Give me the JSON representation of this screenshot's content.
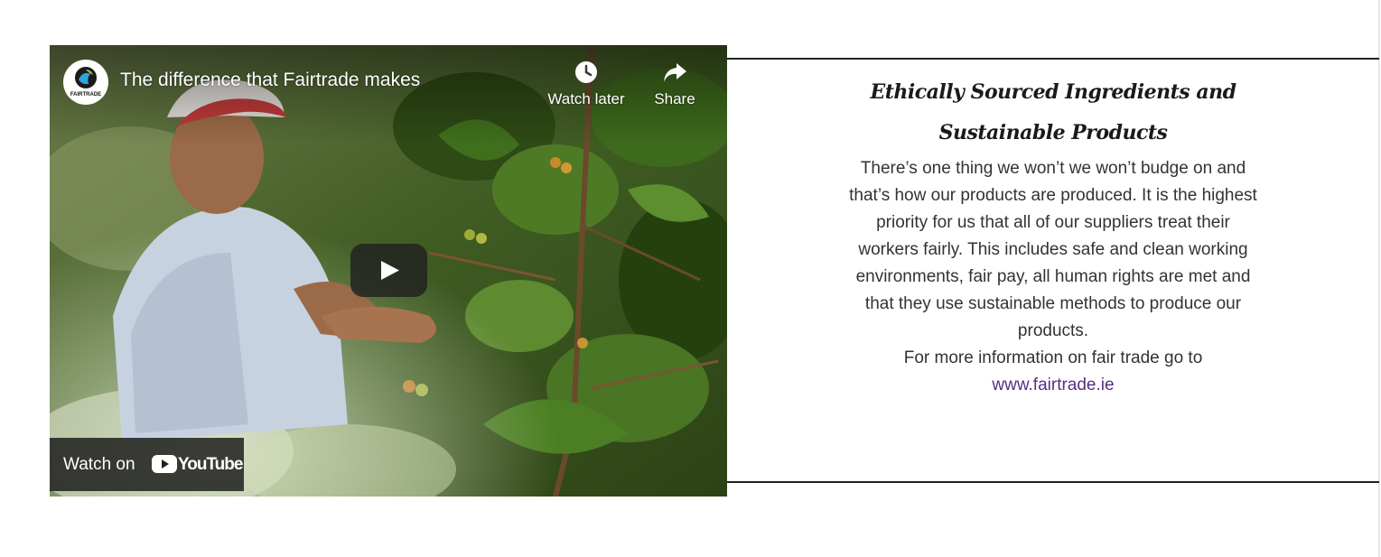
{
  "video": {
    "title": "The difference that Fairtrade makes",
    "channel_logo_text": "FAIRTRADE",
    "watch_later_label": "Watch later",
    "share_label": "Share",
    "watch_on_label": "Watch on",
    "youtube_label": "YouTube",
    "icons": {
      "channel": "fairtrade-logo-icon",
      "watch_later": "clock-icon",
      "share": "share-arrow-icon",
      "play": "play-icon",
      "youtube": "youtube-logo-icon"
    }
  },
  "section": {
    "heading": "Ethically Sourced Ingredients and Sustainable Products",
    "body": "There’s one thing we won’t we won’t budge on and that’s how our products are produced. It is the highest priority for us that all of our suppliers treat their workers fairly. This includes safe and clean working environments, fair pay, all human rights are met and that they use sustainable methods to produce our products.",
    "more_info": "For more information on fair trade go to",
    "link_text": "www.fairtrade.ie"
  },
  "colors": {
    "heading": "#1a1a1a",
    "body_text": "#333333",
    "link": "#5a2d82",
    "rule": "#222222",
    "youtube_red": "#ff0000"
  }
}
